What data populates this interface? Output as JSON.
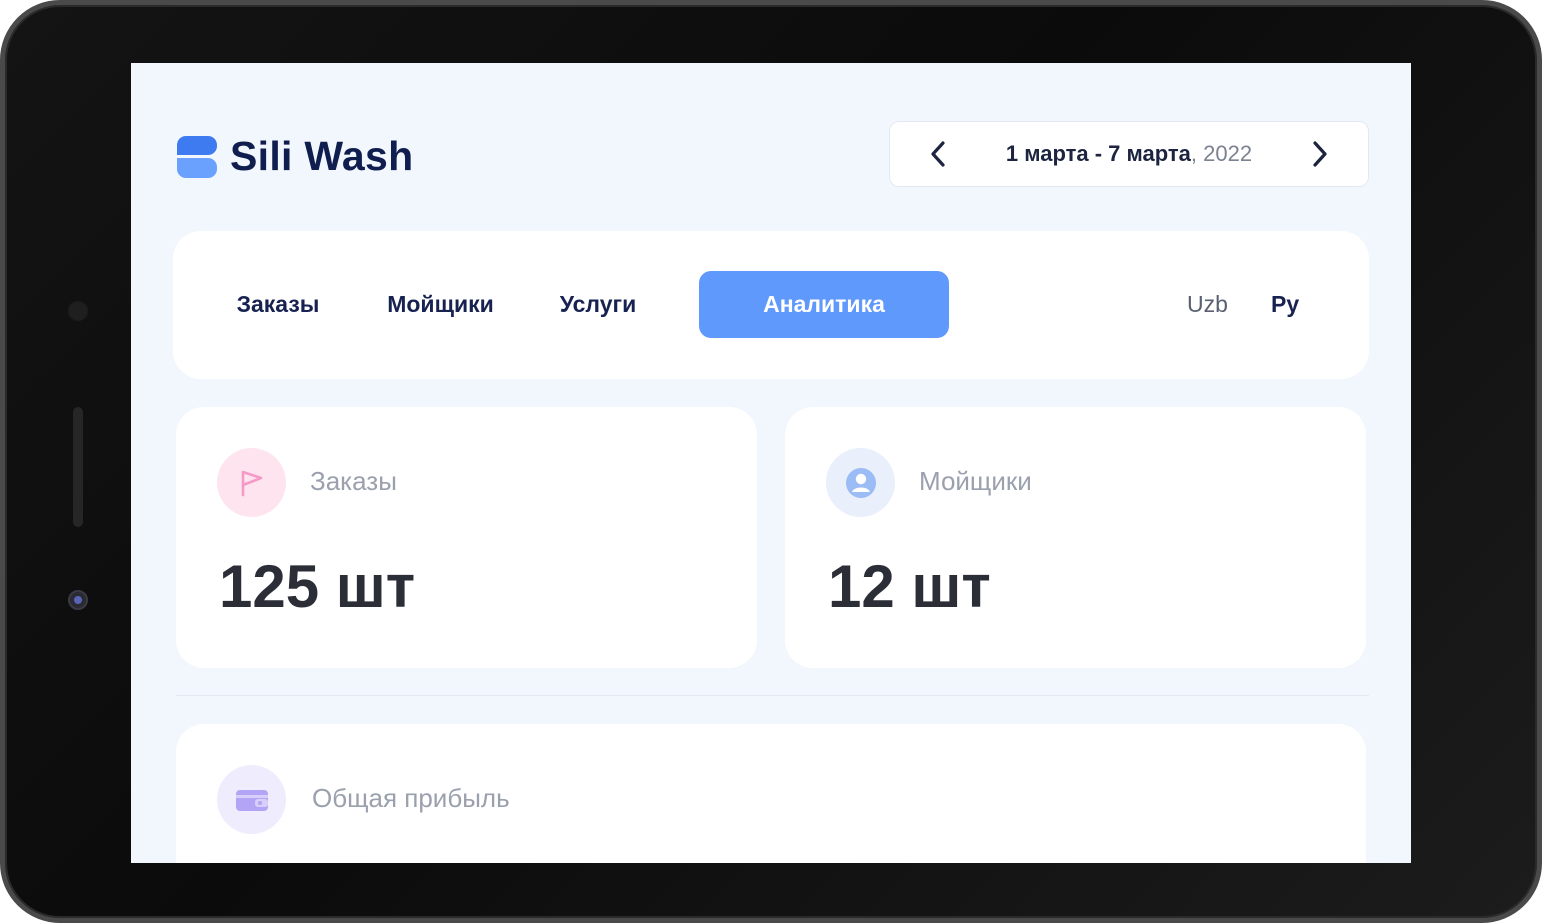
{
  "app": {
    "name": "Sili Wash"
  },
  "date_range": {
    "range": "1 марта - 7 марта",
    "year_suffix": ", 2022"
  },
  "nav": {
    "tabs": [
      {
        "label": "Заказы",
        "active": false
      },
      {
        "label": "Мойщики",
        "active": false
      },
      {
        "label": "Услуги",
        "active": false
      },
      {
        "label": "Аналитика",
        "active": true
      }
    ],
    "languages": [
      {
        "label": "Uzb",
        "active": false
      },
      {
        "label": "Ру",
        "active": true
      }
    ]
  },
  "stats": {
    "orders": {
      "label": "Заказы",
      "value": "125 шт",
      "icon": "flag-icon",
      "icon_bg": "#fde4ef",
      "icon_color": "#f59ac7"
    },
    "washers": {
      "label": "Мойщики",
      "value": "12 шт",
      "icon": "user-icon",
      "icon_bg": "#e9effb",
      "icon_color": "#9cbcf6"
    }
  },
  "profit": {
    "label": "Общая прибыль",
    "icon": "wallet-icon",
    "icon_bg": "#efecfd",
    "icon_color": "#b3a4f5"
  },
  "colors": {
    "accent": "#5f99fb",
    "brand_dark": "#0f1d4f",
    "screen_bg": "#f2f7fe"
  }
}
